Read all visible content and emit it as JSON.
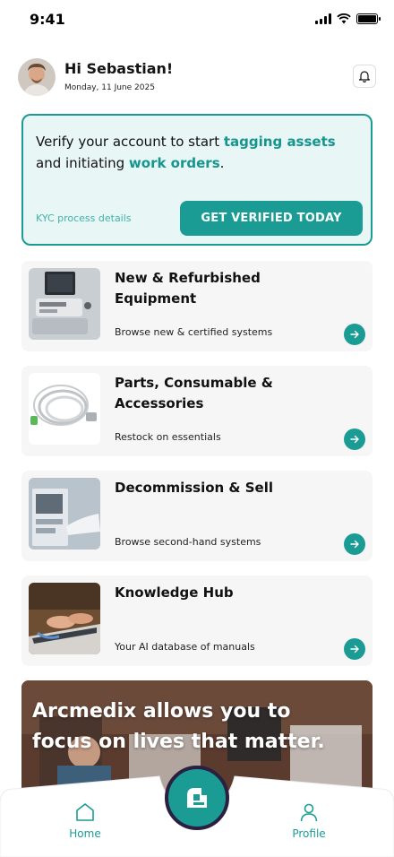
{
  "status_bar": {
    "time": "9:41"
  },
  "header": {
    "greeting": "Hi Sebastian!",
    "date": "Monday, 11 June 2025",
    "avatar_icon": "user-avatar",
    "notification_icon": "bell-icon"
  },
  "verify": {
    "text_before": "Verify your account to start ",
    "highlight_1": "tagging assets",
    "text_middle": " and initiating ",
    "highlight_2": "work orders",
    "text_after": ".",
    "kyc_link": "KYC process details",
    "button": "GET VERIFIED TODAY"
  },
  "categories": [
    {
      "title": "New & Refurbished Equipment",
      "description": "Browse new & certified systems",
      "thumb": "ultrasound-machine-image"
    },
    {
      "title": "Parts, Consumable & Accessories",
      "description": "Restock on essentials",
      "thumb": "medical-cable-image"
    },
    {
      "title": "Decommission & Sell",
      "description": "Browse second-hand systems",
      "thumb": "medical-monitor-image"
    },
    {
      "title": "Knowledge Hub",
      "description": "Your AI database of manuals",
      "thumb": "typing-hands-image"
    }
  ],
  "banner": {
    "text": "Arcmedix allows you to focus on lives that matter."
  },
  "nav": {
    "home": "Home",
    "profile": "Profile"
  },
  "colors": {
    "accent": "#1a9c94",
    "accent_light": "#e8f6f5",
    "fab_ring": "#2b2040"
  }
}
